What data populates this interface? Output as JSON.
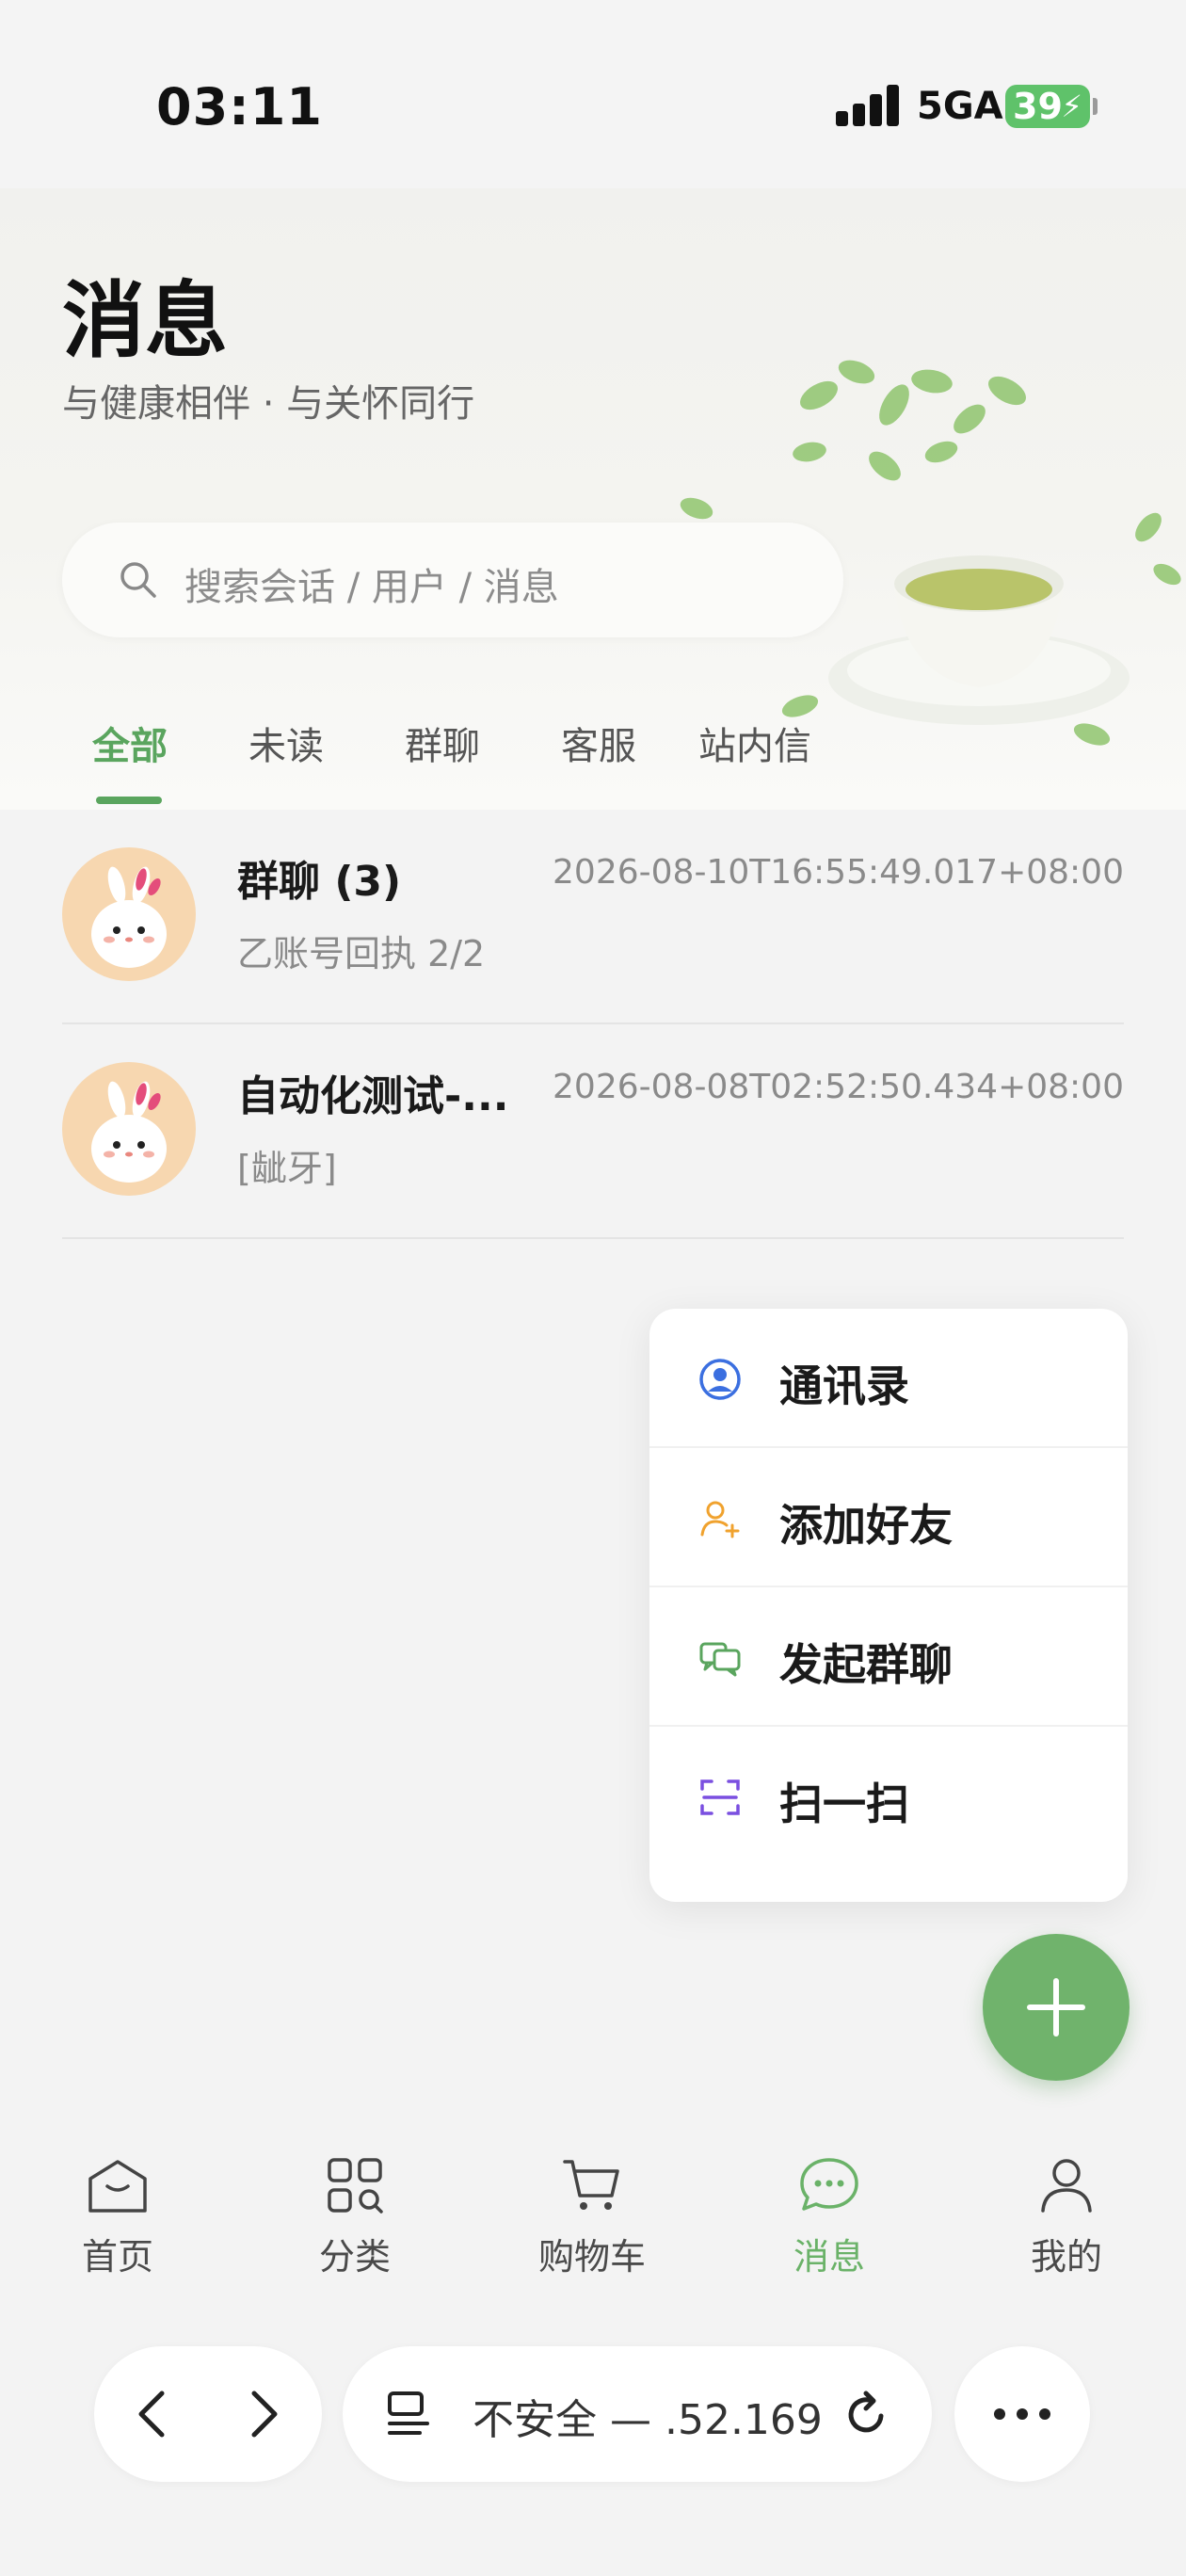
{
  "status_bar": {
    "time": "03:11",
    "network": "5GA",
    "battery": "39"
  },
  "header": {
    "title": "消息",
    "subtitle": "与健康相伴 · 与关怀同行",
    "search_placeholder": "搜索会话 / 用户 / 消息"
  },
  "tabs": [
    {
      "label": "全部",
      "active": true
    },
    {
      "label": "未读",
      "active": false
    },
    {
      "label": "群聊",
      "active": false
    },
    {
      "label": "客服",
      "active": false
    },
    {
      "label": "站内信",
      "active": false
    }
  ],
  "conversations": [
    {
      "title": "群聊 (3)",
      "time": "2026-08-10T16:55:49.017+08:00",
      "preview": "乙账号回执 2/2"
    },
    {
      "title": "自动化测试-...",
      "time": "2026-08-08T02:52:50.434+08:00",
      "preview": "[龇牙]"
    }
  ],
  "popup_menu": [
    {
      "label": "通讯录",
      "icon": "contacts-icon",
      "color": "#3b6fe0"
    },
    {
      "label": "添加好友",
      "icon": "add-friend-icon",
      "color": "#f0a22e"
    },
    {
      "label": "发起群聊",
      "icon": "group-chat-icon",
      "color": "#5aa55e"
    },
    {
      "label": "扫一扫",
      "icon": "scan-icon",
      "color": "#7a4fe0"
    }
  ],
  "bottom_nav": [
    {
      "label": "首页",
      "icon": "home-icon",
      "active": false
    },
    {
      "label": "分类",
      "icon": "category-icon",
      "active": false
    },
    {
      "label": "购物车",
      "icon": "cart-icon",
      "active": false
    },
    {
      "label": "消息",
      "icon": "message-icon",
      "active": true
    },
    {
      "label": "我的",
      "icon": "profile-icon",
      "active": false
    }
  ],
  "browser": {
    "url_text": "不安全 — .52.169"
  },
  "colors": {
    "accent": "#5aa55e",
    "fab": "#70b36c"
  }
}
